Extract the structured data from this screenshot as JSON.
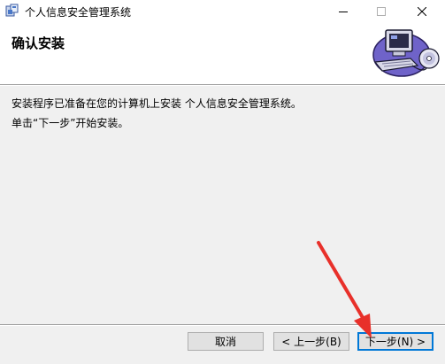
{
  "window": {
    "title": "个人信息安全管理系统",
    "controls": [
      "minimize",
      "maximize",
      "close"
    ]
  },
  "banner": {
    "title": "确认安装",
    "art_icon": "computer-cd-icon"
  },
  "content": {
    "line1": "安装程序已准备在您的计算机上安装 个人信息安全管理系统。",
    "line2": "单击“下一步”开始安装。"
  },
  "buttons": {
    "cancel": "取消",
    "back": "< 上一步(B)",
    "next": "下一步(N) >"
  },
  "annotation": {
    "arrow_color": "#e8302a"
  },
  "colors": {
    "focus_border": "#0078d7",
    "panel_bg": "#f0f0f0"
  }
}
